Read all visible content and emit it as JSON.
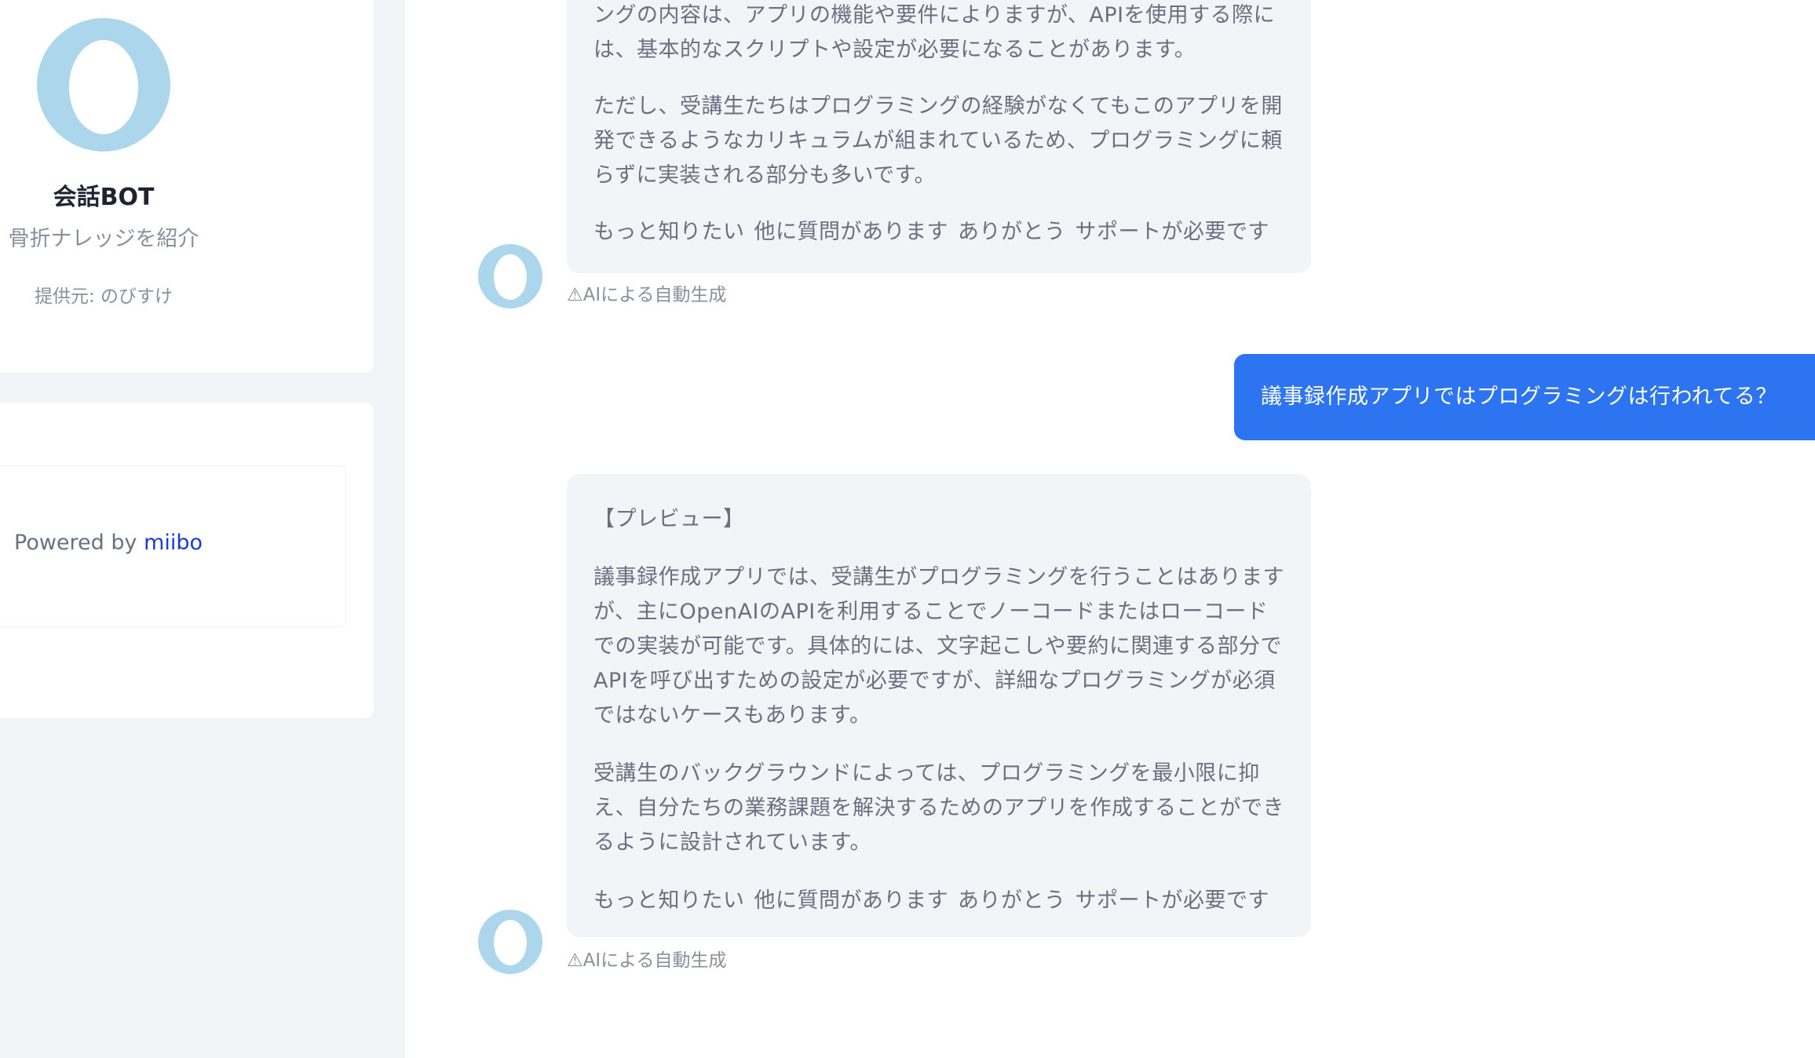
{
  "sidebar": {
    "bot_name": "会話BOT",
    "bot_description": "骨折ナレッジを紹介",
    "provider": "提供元: のびすけ",
    "powered_prefix": "Powered by ",
    "powered_link": "miibo"
  },
  "chat": {
    "messages": [
      {
        "role": "bot",
        "paragraphs": [
          "ングの内容は、アプリの機能や要件によりますが、APIを使用する際には、基本的なスクリプトや設定が必要になることがあります。",
          "ただし、受講生たちはプログラミングの経験がなくてもこのアプリを開発できるようなカリキュラムが組まれているため、プログラミングに頼らずに実装される部分も多いです。"
        ],
        "quick_replies": [
          "もっと知りたい",
          "他に質問があります",
          "ありがとう",
          "サポートが必要です"
        ],
        "ai_note": "⚠AIによる自動生成"
      },
      {
        "role": "user",
        "text": "議事録作成アプリではプログラミングは行われてる？"
      },
      {
        "role": "bot",
        "paragraphs": [
          "【プレビュー】",
          "議事録作成アプリでは、受講生がプログラミングを行うことはありますが、主にOpenAIのAPIを利用することでノーコードまたはローコードでの実装が可能です。具体的には、文字起こしや要約に関連する部分でAPIを呼び出すための設定が必要ですが、詳細なプログラミングが必須ではないケースもあります。",
          "受講生のバックグラウンドによっては、プログラミングを最小限に抑え、自分たちの業務課題を解決するためのアプリを作成することができるように設計されています。"
        ],
        "quick_replies": [
          "もっと知りたい",
          "他に質問があります",
          "ありがとう",
          "サポートが必要です"
        ],
        "ai_note": "⚠AIによる自動生成"
      }
    ]
  },
  "colors": {
    "page_bg": "#f3f4f8",
    "user_bubble": "#2d74f0",
    "bot_bubble": "#f3f4f8",
    "avatar": "#acd6ec",
    "link": "#1a3cd6"
  },
  "icons": {
    "bot_avatar": "bot-avatar-icon"
  }
}
